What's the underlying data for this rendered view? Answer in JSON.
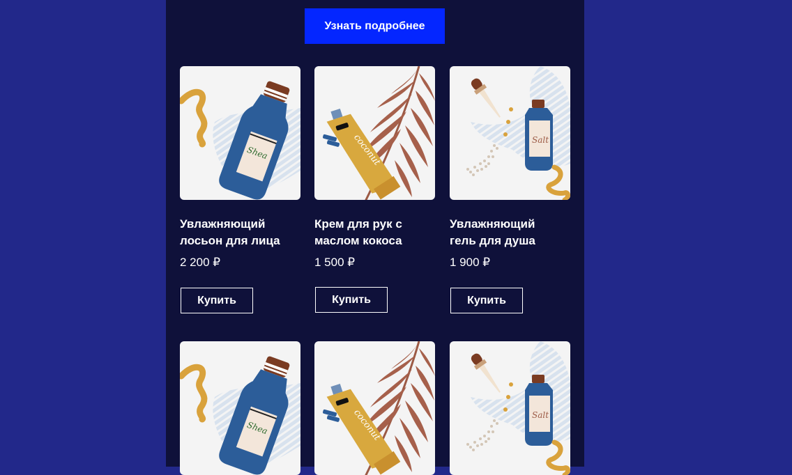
{
  "cta": {
    "label": "Узнать подробнее"
  },
  "accent_color": "#0426ff",
  "products": [
    {
      "name_line1": "Увлажняющий",
      "name_line2": "лосьон для лица",
      "price": "2 200 ₽",
      "buy_label": "Купить",
      "image": "lotion-bottle-image"
    },
    {
      "name_line1": "Крем для рук с",
      "name_line2": "маслом кокоса",
      "price": "1 500 ₽",
      "buy_label": "Купить",
      "image": "coconut-cream-tube-image"
    },
    {
      "name_line1": "Увлажняющий",
      "name_line2": "гель для душа",
      "price": "1 900 ₽",
      "buy_label": "Купить",
      "image": "shower-gel-dropper-image"
    }
  ],
  "second_row_images": [
    "lotion-bottle-image",
    "coconut-cream-tube-image",
    "shower-gel-dropper-image"
  ]
}
